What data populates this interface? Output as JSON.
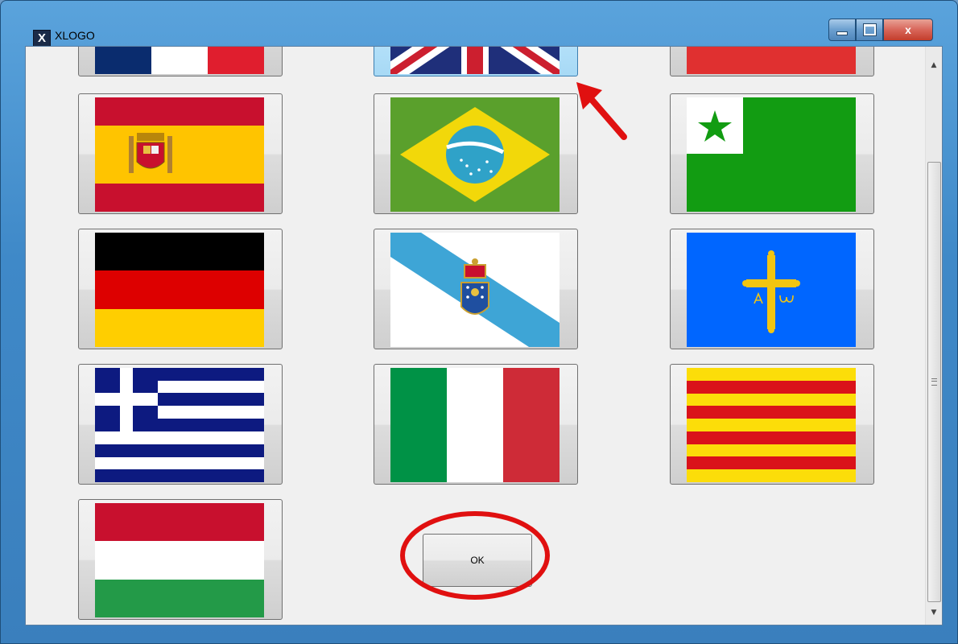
{
  "window": {
    "title": "XLOGO",
    "app_icon_glyph": "X",
    "controls": {
      "minimize": "minimize-icon",
      "maximize": "maximize-icon",
      "close": "close-icon",
      "close_glyph": "x"
    }
  },
  "flags": [
    {
      "name": "france",
      "state": "partially-visible"
    },
    {
      "name": "united-kingdom",
      "state": "selected"
    },
    {
      "name": "unknown-red",
      "state": "partially-visible"
    },
    {
      "name": "spain"
    },
    {
      "name": "brazil"
    },
    {
      "name": "esperanto"
    },
    {
      "name": "germany"
    },
    {
      "name": "galicia"
    },
    {
      "name": "asturias"
    },
    {
      "name": "greece"
    },
    {
      "name": "italy"
    },
    {
      "name": "catalonia"
    },
    {
      "name": "hungary"
    }
  ],
  "ok_button": {
    "label": "OK"
  },
  "annotation_color": "#e01010"
}
